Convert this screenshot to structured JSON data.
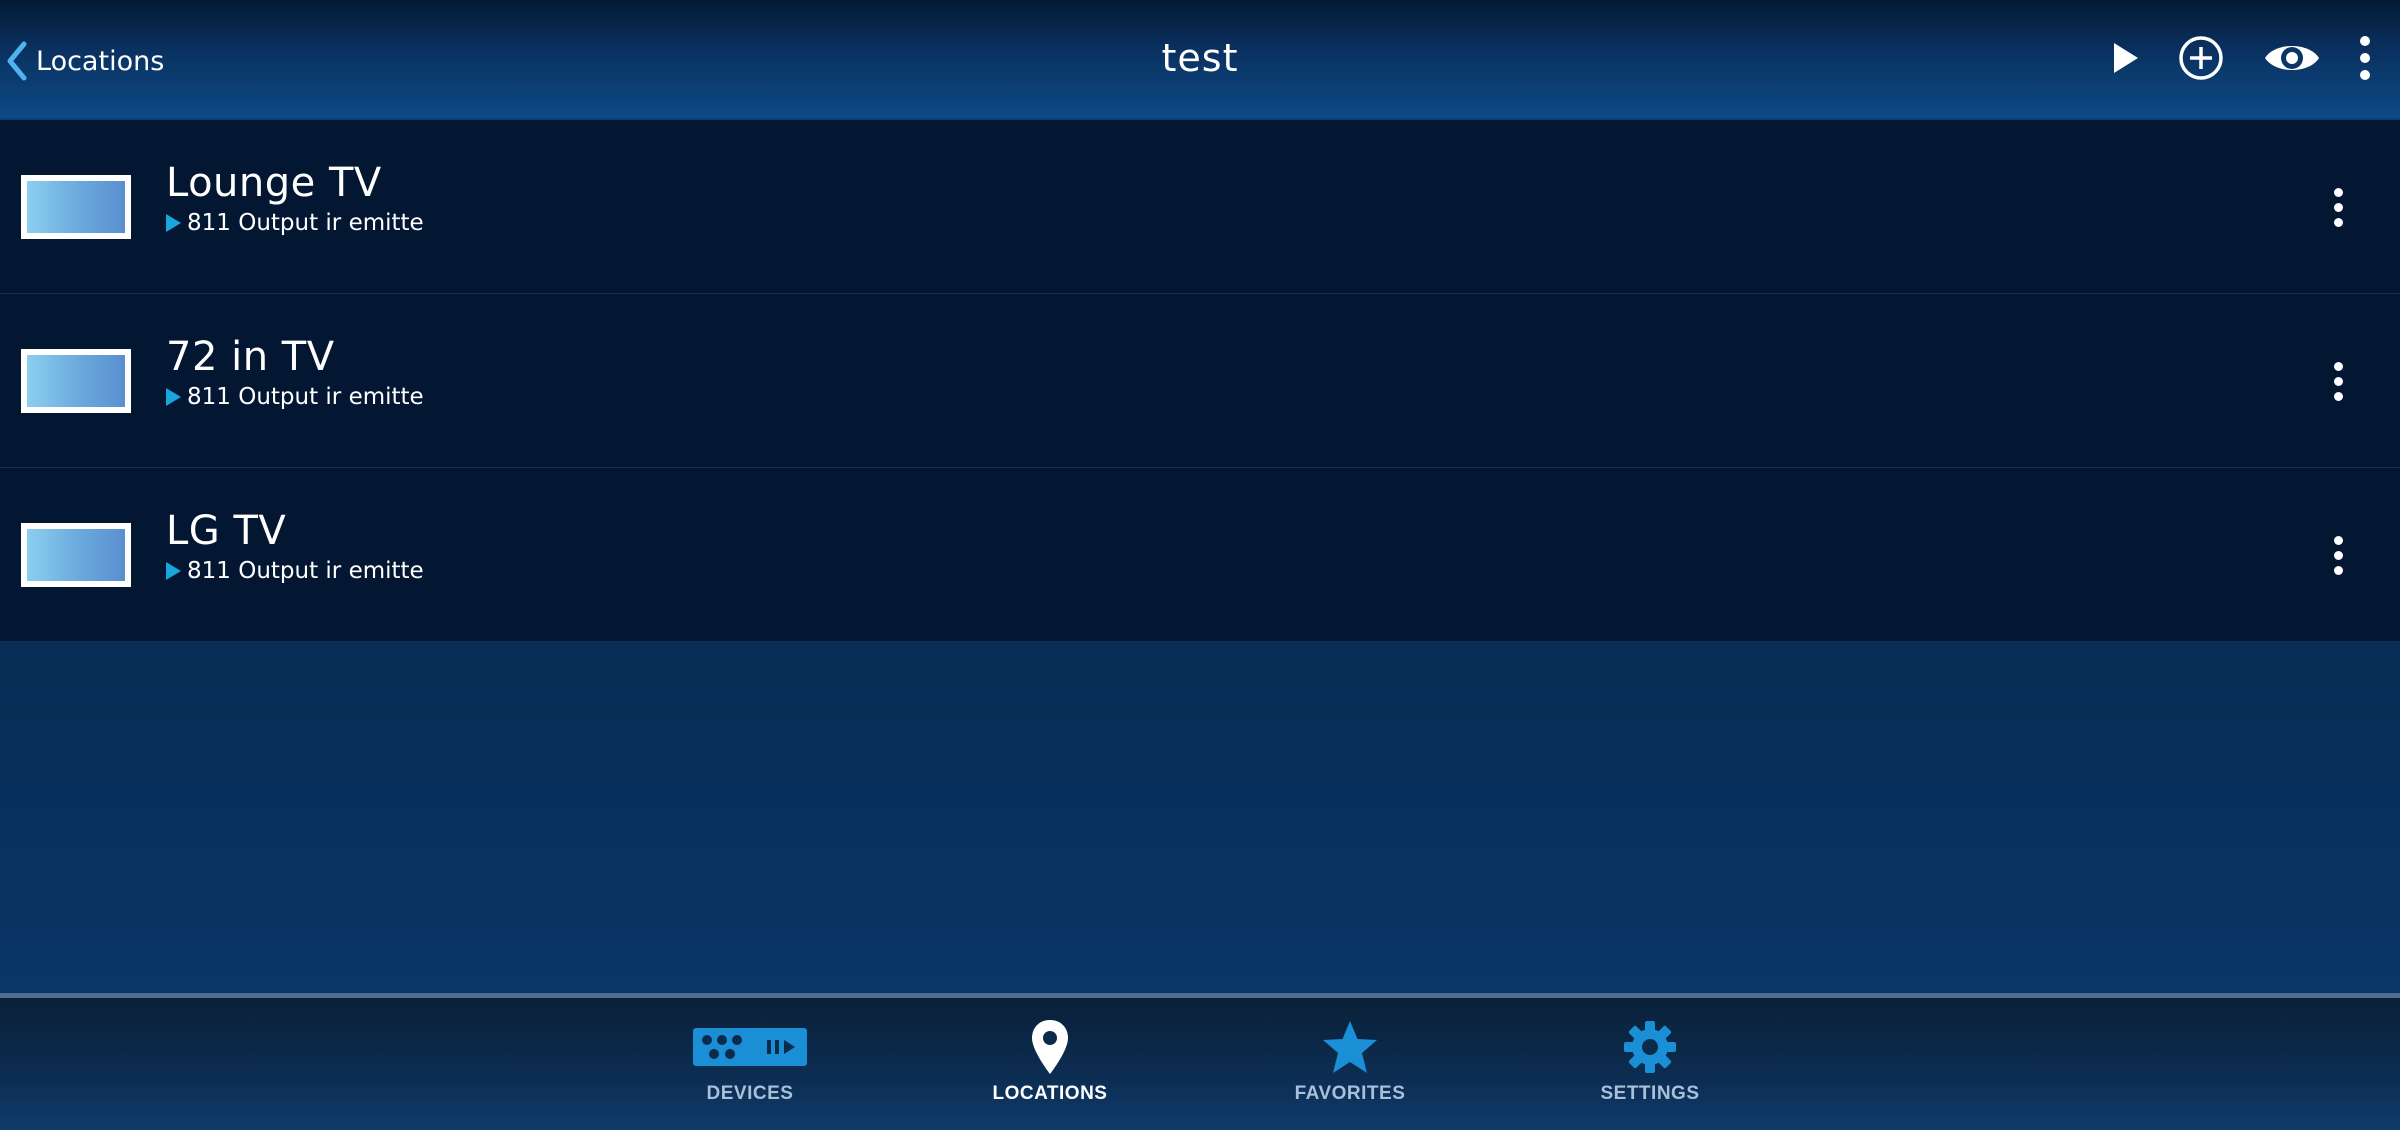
{
  "header": {
    "back_label": "Locations",
    "title": "test",
    "actions": [
      {
        "name": "play-icon"
      },
      {
        "name": "add-circle-icon"
      },
      {
        "name": "eye-icon"
      },
      {
        "name": "more-vertical-icon"
      }
    ]
  },
  "devices": [
    {
      "name": "Lounge TV",
      "output": "811 Output ir emitte",
      "icon": "tv-icon"
    },
    {
      "name": "72 in TV",
      "output": "811 Output ir emitte",
      "icon": "tv-icon"
    },
    {
      "name": "LG TV",
      "output": "811 Output ir emitte",
      "icon": "tv-icon"
    }
  ],
  "bottom_nav": {
    "active": "LOCATIONS",
    "items": [
      {
        "label": "DEVICES",
        "icon": "devices-icon"
      },
      {
        "label": "LOCATIONS",
        "icon": "location-pin-icon"
      },
      {
        "label": "FAVORITES",
        "icon": "star-icon"
      },
      {
        "label": "SETTINGS",
        "icon": "gear-icon"
      }
    ]
  },
  "colors": {
    "accent": "#1b8fd6",
    "row_background": "#031733",
    "header_top": "#041a35",
    "header_bottom": "#0d4a86",
    "nav_label_inactive": "#a8c0d8",
    "nav_label_active": "#ffffff"
  }
}
